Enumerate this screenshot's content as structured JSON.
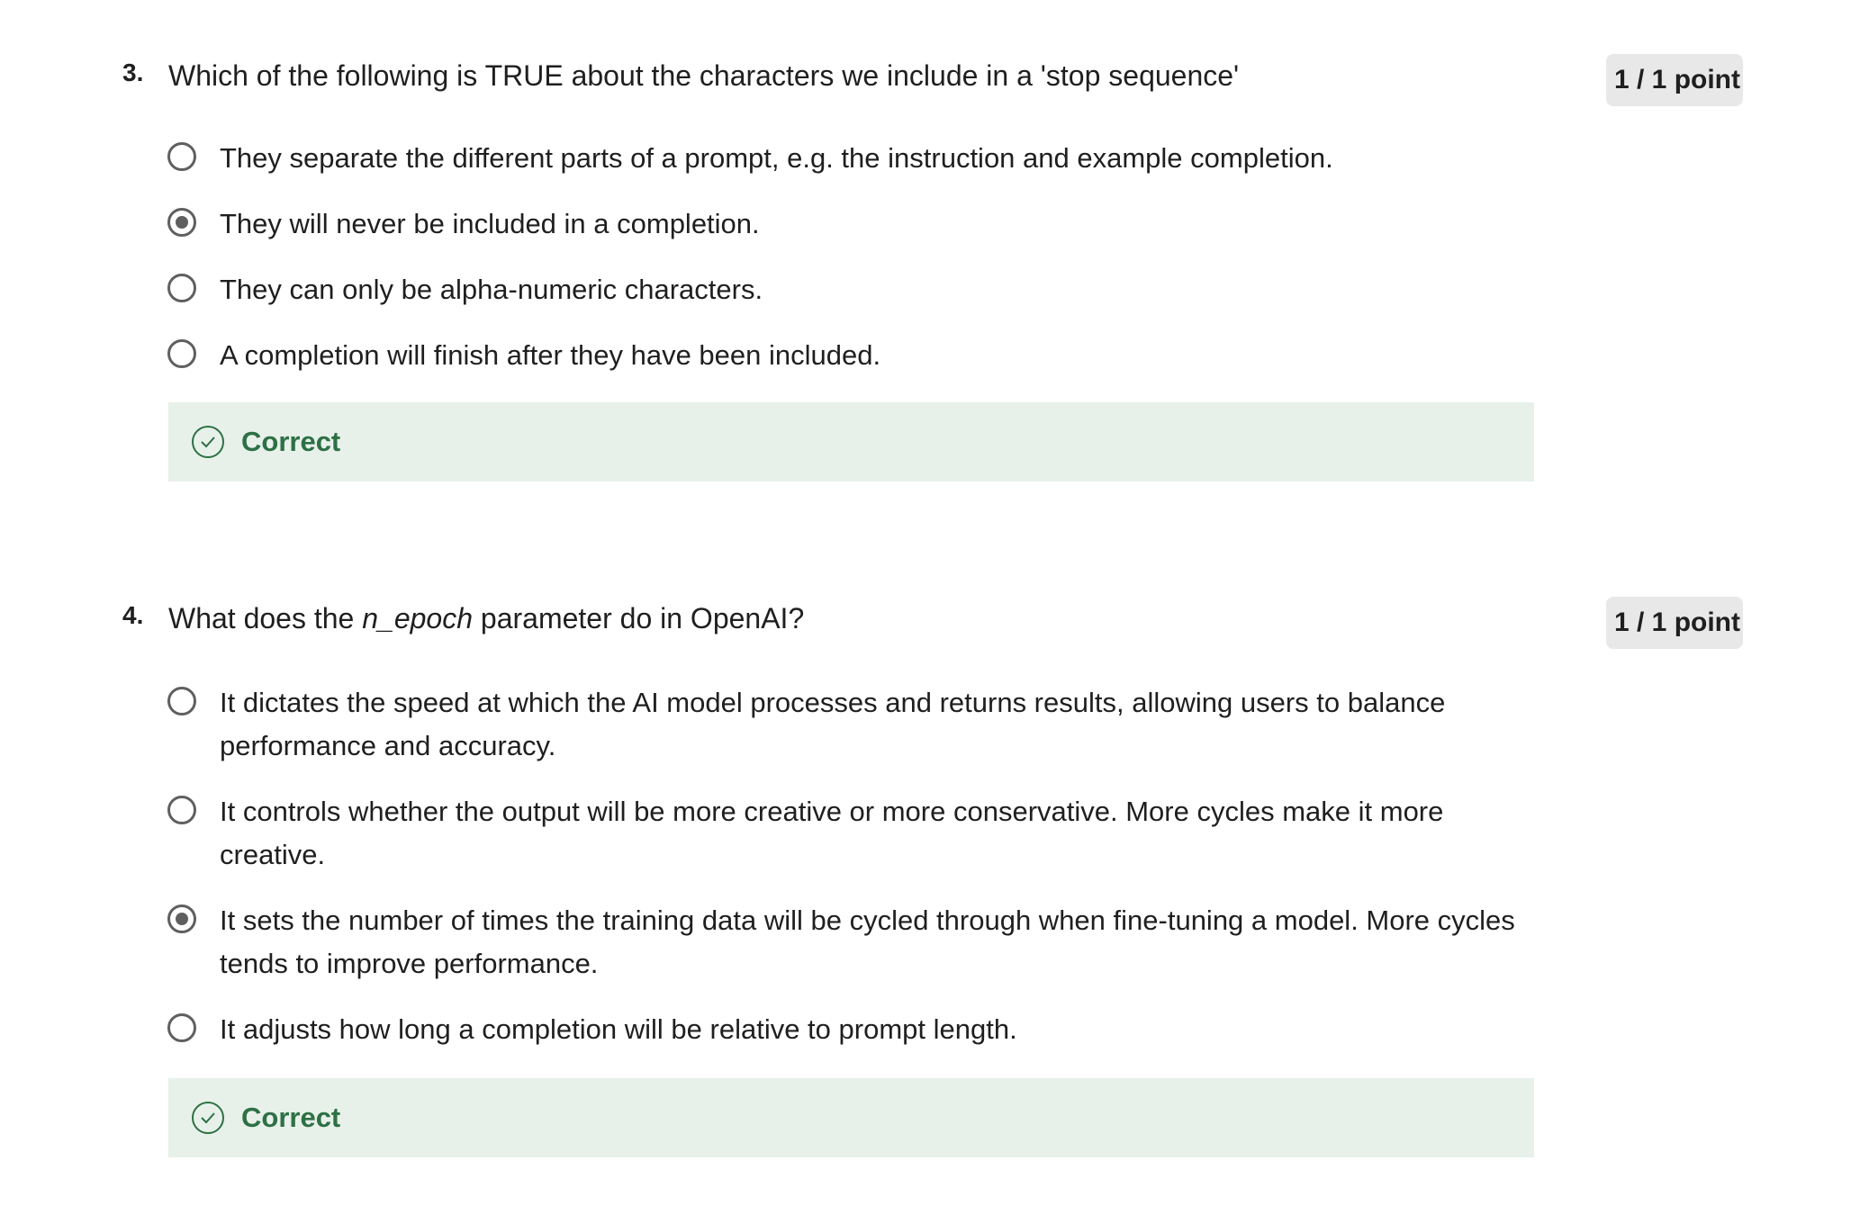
{
  "questions": [
    {
      "number": "3.",
      "text": "Which of the following is TRUE about the characters we include in a 'stop sequence'",
      "points": "1 / 1 point",
      "options": [
        {
          "label": "They separate the different parts of a prompt, e.g. the instruction and example completion.",
          "selected": false
        },
        {
          "label": "They will never be included in a completion.",
          "selected": true
        },
        {
          "label": "They can only be alpha-numeric characters.",
          "selected": false
        },
        {
          "label": "A completion will finish after they have been included.",
          "selected": false
        }
      ],
      "feedback": "Correct"
    },
    {
      "number": "4.",
      "text_before": "What does the ",
      "text_em": "n_epoch",
      "text_after": " parameter do in OpenAI?",
      "points": "1 / 1 point",
      "options": [
        {
          "label": "It dictates the speed at which the AI model processes and returns results, allowing users to balance performance and accuracy.",
          "selected": false
        },
        {
          "label": "It controls whether the output will be more creative or more conservative. More cycles make it more creative.",
          "selected": false
        },
        {
          "label": "It sets the number of times the training data will be cycled through when fine-tuning a model. More cycles tends to improve performance.",
          "selected": true
        },
        {
          "label": "It adjusts how long a completion will be relative to prompt length.",
          "selected": false
        }
      ],
      "feedback": "Correct"
    }
  ],
  "colors": {
    "feedback_bg": "#e7f1ea",
    "feedback_text": "#2e7045",
    "points_bg": "#e8e8e8",
    "radio": "#5f5f5f"
  },
  "icons": {
    "radio_unselected": "radio-unselected-icon",
    "radio_selected": "radio-selected-icon",
    "feedback": "check-circle-icon"
  }
}
